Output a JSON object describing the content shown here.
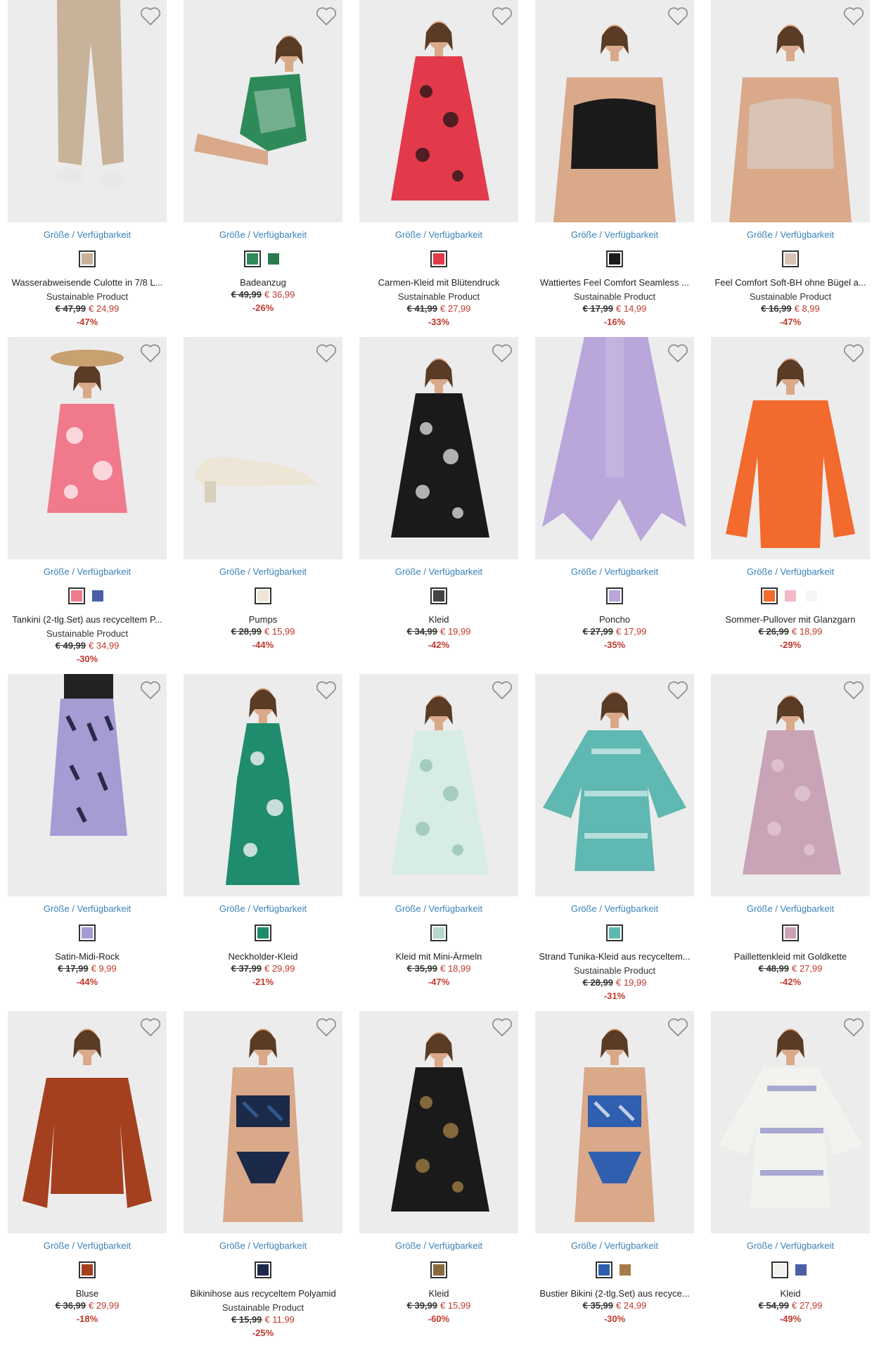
{
  "size_link_label": "Größe / Verfügbarkeit",
  "icons": {
    "favorite": "heart-outline-icon"
  },
  "colors": {
    "link": "#3a82b9",
    "sale": "#c0392b",
    "photo_bg": "#ececec"
  },
  "products": [
    {
      "name": "Wasserabweisende Culotte in 7/8 L...",
      "tag": "Sustainable Product",
      "old_price": "€ 47,99",
      "new_price": "€ 24,99",
      "discount": "-47%",
      "garment": "pants",
      "colors": [
        "#c8b29a"
      ],
      "swatches": [
        "#c8b29a"
      ]
    },
    {
      "name": "Badeanzug",
      "tag": "",
      "old_price": "€ 49,99",
      "new_price": "€ 36,99",
      "discount": "-26%",
      "garment": "swimsuit",
      "colors": [
        "#2f8a5a",
        "#f4f4f0"
      ],
      "swatches": [
        "#2f8a5a",
        "#2a7a50"
      ]
    },
    {
      "name": "Carmen-Kleid mit Blütendruck",
      "tag": "Sustainable Product",
      "old_price": "€ 41,99",
      "new_price": "€ 27,99",
      "discount": "-33%",
      "garment": "dress",
      "colors": [
        "#e23a4a",
        "#111111"
      ],
      "swatches": [
        "#e23a4a"
      ]
    },
    {
      "name": "Wattiertes Feel Comfort Seamless ...",
      "tag": "Sustainable Product",
      "old_price": "€ 17,99",
      "new_price": "€ 14,99",
      "discount": "-16%",
      "garment": "bra",
      "colors": [
        "#1a1a1a"
      ],
      "swatches": [
        "#1a1a1a"
      ]
    },
    {
      "name": "Feel Comfort Soft-BH ohne Bügel a...",
      "tag": "Sustainable Product",
      "old_price": "€ 16,99",
      "new_price": "€ 8,99",
      "discount": "-47%",
      "garment": "bra",
      "colors": [
        "#d9c3b4"
      ],
      "swatches": [
        "#d9c3b4"
      ]
    },
    {
      "name": "Tankini (2-tlg.Set) aus recyceltem P...",
      "tag": "Sustainable Product",
      "old_price": "€ 49,99",
      "new_price": "€ 34,99",
      "discount": "-30%",
      "garment": "top",
      "colors": [
        "#f07a8c",
        "#ffffff"
      ],
      "swatches": [
        "#f07a8c",
        "#4a5fa8"
      ]
    },
    {
      "name": "Pumps",
      "tag": "",
      "old_price": "€ 28,99",
      "new_price": "€ 15,99",
      "discount": "-44%",
      "garment": "shoe",
      "colors": [
        "#ede6d6"
      ],
      "swatches": [
        "#ede6d6"
      ]
    },
    {
      "name": "Kleid",
      "tag": "",
      "old_price": "€ 34,99",
      "new_price": "€ 19,99",
      "discount": "-42%",
      "garment": "dress",
      "colors": [
        "#1a1a1a",
        "#f2f2f2"
      ],
      "swatches": [
        "#444444"
      ]
    },
    {
      "name": "Poncho",
      "tag": "",
      "old_price": "€ 27,99",
      "new_price": "€ 17,99",
      "discount": "-35%",
      "garment": "poncho",
      "colors": [
        "#b9a6da"
      ],
      "swatches": [
        "#b9a6da"
      ]
    },
    {
      "name": "Sommer-Pullover mit Glanzgarn",
      "tag": "",
      "old_price": "€ 26,99",
      "new_price": "€ 18,99",
      "discount": "-29%",
      "garment": "sweater",
      "colors": [
        "#f26a2e"
      ],
      "swatches": [
        "#f26a2e",
        "#f4b9c6",
        "#f6f6f6"
      ]
    },
    {
      "name": "Satin-Midi-Rock",
      "tag": "",
      "old_price": "€ 17,99",
      "new_price": "€ 9,99",
      "discount": "-44%",
      "garment": "skirt",
      "colors": [
        "#a79bd4",
        "#2a2a4a"
      ],
      "swatches": [
        "#a79bd4"
      ]
    },
    {
      "name": "Neckholder-Kleid",
      "tag": "",
      "old_price": "€ 37,99",
      "new_price": "€ 29,99",
      "discount": "-21%",
      "garment": "longdress",
      "colors": [
        "#1f8c6e",
        "#f2f2f2"
      ],
      "swatches": [
        "#1f8c6e"
      ]
    },
    {
      "name": "Kleid mit Mini-Ärmeln",
      "tag": "",
      "old_price": "€ 35,99",
      "new_price": "€ 18,99",
      "discount": "-47%",
      "garment": "dress",
      "colors": [
        "#d8ece6",
        "#8fbfb0"
      ],
      "swatches": [
        "#b7d8cc"
      ]
    },
    {
      "name": "Strand Tunika-Kleid aus recyceltem...",
      "tag": "Sustainable Product",
      "old_price": "€ 28,99",
      "new_price": "€ 19,99",
      "discount": "-31%",
      "garment": "tunic",
      "colors": [
        "#5fb8b2",
        "#d9f0ed"
      ],
      "swatches": [
        "#5fb8b2"
      ]
    },
    {
      "name": "Paillettenkleid mit Goldkette",
      "tag": "",
      "old_price": "€ 48,99",
      "new_price": "€ 27,99",
      "discount": "-42%",
      "garment": "dress",
      "colors": [
        "#c9a3b6",
        "#e6ccd8"
      ],
      "swatches": [
        "#c9a3b6"
      ]
    },
    {
      "name": "Bluse",
      "tag": "",
      "old_price": "€ 36,99",
      "new_price": "€ 29,99",
      "discount": "-18%",
      "garment": "blouse",
      "colors": [
        "#a4401f"
      ],
      "swatches": [
        "#a4401f"
      ]
    },
    {
      "name": "Bikinihose aus recyceltem Polyamid",
      "tag": "Sustainable Product",
      "old_price": "€ 15,99",
      "new_price": "€ 11,99",
      "discount": "-25%",
      "garment": "bikini",
      "colors": [
        "#1c2a4a",
        "#3a6aa8"
      ],
      "swatches": [
        "#1c2a4a"
      ]
    },
    {
      "name": "Kleid",
      "tag": "",
      "old_price": "€ 39,99",
      "new_price": "€ 15,99",
      "discount": "-60%",
      "garment": "dress",
      "colors": [
        "#1a1a1a",
        "#b08a4a"
      ],
      "swatches": [
        "#8a6a3a"
      ]
    },
    {
      "name": "Bustier Bikini (2-tlg.Set) aus recyce...",
      "tag": "",
      "old_price": "€ 35,99",
      "new_price": "€ 24,99",
      "discount": "-30%",
      "garment": "bikini",
      "colors": [
        "#2f5fae",
        "#ffffff"
      ],
      "swatches": [
        "#2f5fae",
        "#a67a4a"
      ]
    },
    {
      "name": "Kleid",
      "tag": "",
      "old_price": "€ 54,99",
      "new_price": "€ 27,99",
      "discount": "-49%",
      "garment": "tunic",
      "colors": [
        "#f2f2ee",
        "#8a8ac8"
      ],
      "swatches": [
        "#f2f2ee",
        "#4a5fa8"
      ]
    }
  ]
}
